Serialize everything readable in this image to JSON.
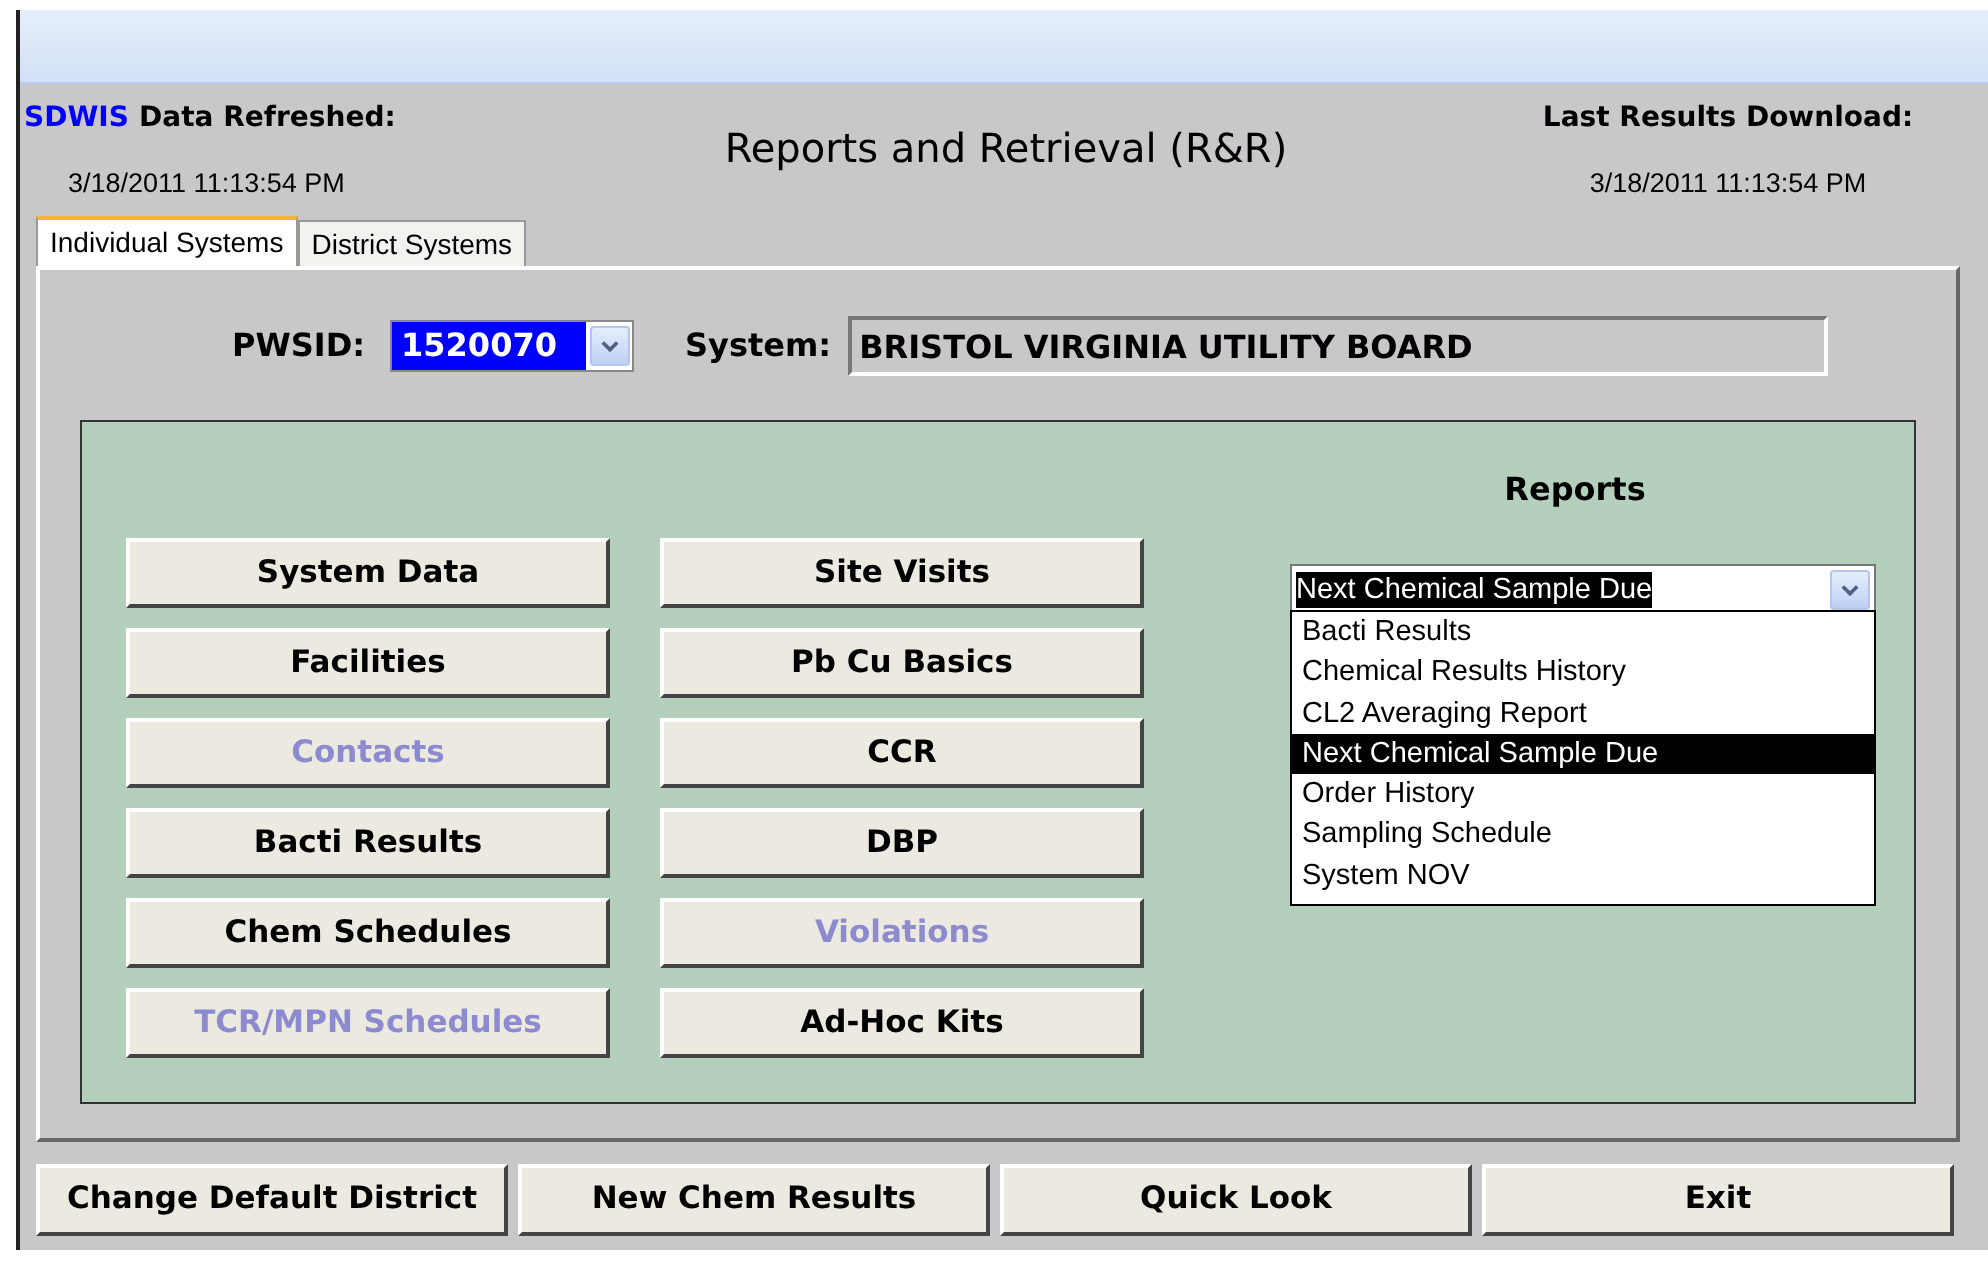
{
  "header": {
    "app_name": "SDWIS",
    "refreshed_label": "Data Refreshed:",
    "refreshed_time": "3/18/2011 11:13:54 PM",
    "title": "Reports and Retrieval (R&R)",
    "download_label": "Last Results Download:",
    "download_time": "3/18/2011 11:13:54 PM"
  },
  "tabs": [
    {
      "label": "Individual Systems",
      "selected": true
    },
    {
      "label": "District Systems",
      "selected": false
    }
  ],
  "pwsid": {
    "label": "PWSID:",
    "value": "1520070"
  },
  "system": {
    "label": "System:",
    "value": "BRISTOL VIRGINIA UTILITY BOARD"
  },
  "buttons_left": [
    {
      "label": "System Data",
      "disabled": false
    },
    {
      "label": "Facilities",
      "disabled": false
    },
    {
      "label": "Contacts",
      "disabled": true
    },
    {
      "label": "Bacti Results",
      "disabled": false
    },
    {
      "label": "Chem Schedules",
      "disabled": false
    },
    {
      "label": "TCR/MPN Schedules",
      "disabled": true
    }
  ],
  "buttons_right": [
    {
      "label": "Site Visits",
      "disabled": false
    },
    {
      "label": "Pb Cu Basics",
      "disabled": false
    },
    {
      "label": "CCR",
      "disabled": false
    },
    {
      "label": "DBP",
      "disabled": false
    },
    {
      "label": "Violations",
      "disabled": true
    },
    {
      "label": "Ad-Hoc Kits",
      "disabled": false
    }
  ],
  "reports": {
    "label": "Reports",
    "value": "Next Chemical Sample Due",
    "expanded": true,
    "options": [
      {
        "label": "Bacti Results",
        "selected": false
      },
      {
        "label": "Chemical Results History",
        "selected": false
      },
      {
        "label": "CL2 Averaging Report",
        "selected": false
      },
      {
        "label": "Next Chemical Sample Due",
        "selected": true
      },
      {
        "label": "Order History",
        "selected": false
      },
      {
        "label": "Sampling Schedule",
        "selected": false
      },
      {
        "label": "System NOV",
        "selected": false
      }
    ]
  },
  "footer_buttons": [
    "Change Default District",
    "New Chem Results",
    "Quick Look",
    "Exit"
  ]
}
